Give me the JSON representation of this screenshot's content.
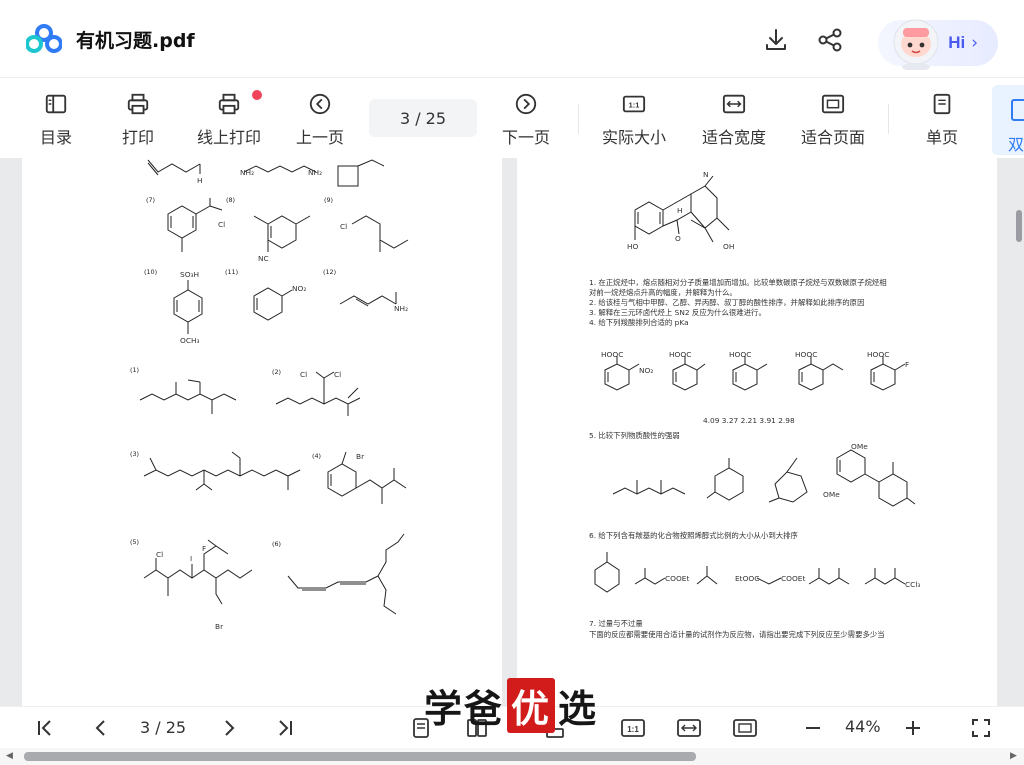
{
  "header": {
    "file_name": "有机习题.pdf",
    "assistant_label": "Hi",
    "download_icon": "download-icon",
    "share_icon": "share-icon"
  },
  "toolbar": {
    "items": [
      {
        "label": "目录",
        "icon": "toc-icon"
      },
      {
        "label": "打印",
        "icon": "print-icon"
      },
      {
        "label": "线上打印",
        "icon": "online-print-icon"
      },
      {
        "label": "上一页",
        "icon": "prev-page-icon"
      },
      {
        "label": "下一页",
        "icon": "next-page-icon"
      },
      {
        "label": "实际大小",
        "icon": "actual-size-icon"
      },
      {
        "label": "适合宽度",
        "icon": "fit-width-icon"
      },
      {
        "label": "适合页面",
        "icon": "fit-page-icon"
      },
      {
        "label": "单页",
        "icon": "single-page-icon"
      },
      {
        "label": "双",
        "icon": "double-page-icon"
      }
    ],
    "page_indicator": "3   / 25"
  },
  "document": {
    "left_page": {
      "labels": [
        "(7)",
        "(8)",
        "(9)",
        "(10)",
        "(11)",
        "(12)",
        "(1)",
        "(2)",
        "(3)",
        "(4)",
        "(5)",
        "(6)"
      ],
      "atoms": {
        "h": "H",
        "nh2a": "NH₂",
        "nh2b": "NH₂",
        "cl1": "Cl",
        "cl2": "Cl",
        "cn": "NC",
        "so3h": "SO₃H",
        "och3": "OCH₃",
        "no2": "NO₂",
        "nh2c": "NH₂",
        "cl3": "Cl",
        "cl4": "Cl",
        "br1": "Br",
        "cl5": "Cl",
        "i1": "I",
        "f1": "F",
        "br2": "Br"
      }
    },
    "right_page": {
      "questions": [
        "1. 在正烷烃中，熔点随相对分子质量增加而增加。比较单数碳原子烷烃与双数碳原子烷烃相",
        "对前一烷烃熔点升高的幅度，并解释为什么。",
        "2. 给该桂与气相中甲醇、乙醇、异丙醇、叔丁醇的酸性排序，并解释如此排序的原因",
        "3. 解释在三元环卤代烃上 SN2 反应为什么很难进行。",
        "4. 给下列羧酸排列合适的 pKa"
      ],
      "pka_values": "4.09    3.27    2.21    3.91    2.98",
      "q5": "5. 比较下列物质酸性的强弱",
      "q6": "6. 给下列含有羰基的化合物按照烯醇式比例的大小从小到大排序",
      "q7_title": "7. 过量与不过量",
      "q7_body": "下面的反应都需要使用合适计量的试剂作为反应物，请指出要完成下列反应至少需要多少当",
      "atoms": {
        "n": "N",
        "h": "H",
        "ho": "HO",
        "o": "O",
        "oh": "OH",
        "hooc": "HOOC",
        "no2": "NO₂",
        "f": "F",
        "ome": "OMe",
        "cooet": "COOEt",
        "etooc": "EtOOC",
        "ccl3": "CCl₃"
      }
    }
  },
  "bottom": {
    "page_indicator": "3   / 25",
    "zoom": "44%"
  },
  "watermark": {
    "part1": "学爸",
    "part2": "优",
    "part3": "选"
  }
}
